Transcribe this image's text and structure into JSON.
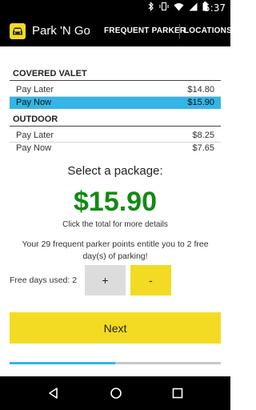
{
  "status_bar": {
    "time": "5:37",
    "icons": [
      "bluetooth-icon",
      "vibrate-icon",
      "wifi-icon",
      "cell-signal-icon",
      "battery-icon"
    ]
  },
  "app_bar": {
    "title": "Park 'N Go",
    "logo_icon": "car-icon",
    "actions": [
      "FREQUENT PARKER",
      "LOCATIONS"
    ]
  },
  "sections": [
    {
      "title": "COVERED VALET",
      "rows": [
        {
          "label": "Pay Later",
          "price": "$14.80",
          "selected": false
        },
        {
          "label": "Pay Now",
          "price": "$15.90",
          "selected": true
        }
      ]
    },
    {
      "title": "OUTDOOR",
      "rows": [
        {
          "label": "Pay Later",
          "price": "$8.25",
          "selected": false
        },
        {
          "label": "Pay Now",
          "price": "$7.65",
          "selected": false
        }
      ]
    }
  ],
  "package": {
    "heading": "Select a package:",
    "total": "$15.90",
    "hint": "Click the total for more details"
  },
  "points_message": "Your 29 frequent parker points entitle you to 2 free day(s) of parking!",
  "free_days": {
    "label": "Free days used: 2",
    "plus_label": "+",
    "minus_label": "-"
  },
  "next_label": "Next",
  "progress": 0.5,
  "colors": {
    "accent_yellow": "#f3db23",
    "selection_blue": "#33b5e5",
    "total_green": "#148a14"
  },
  "nav_bar": {
    "icons": [
      "back-icon",
      "home-icon",
      "recents-icon"
    ]
  }
}
